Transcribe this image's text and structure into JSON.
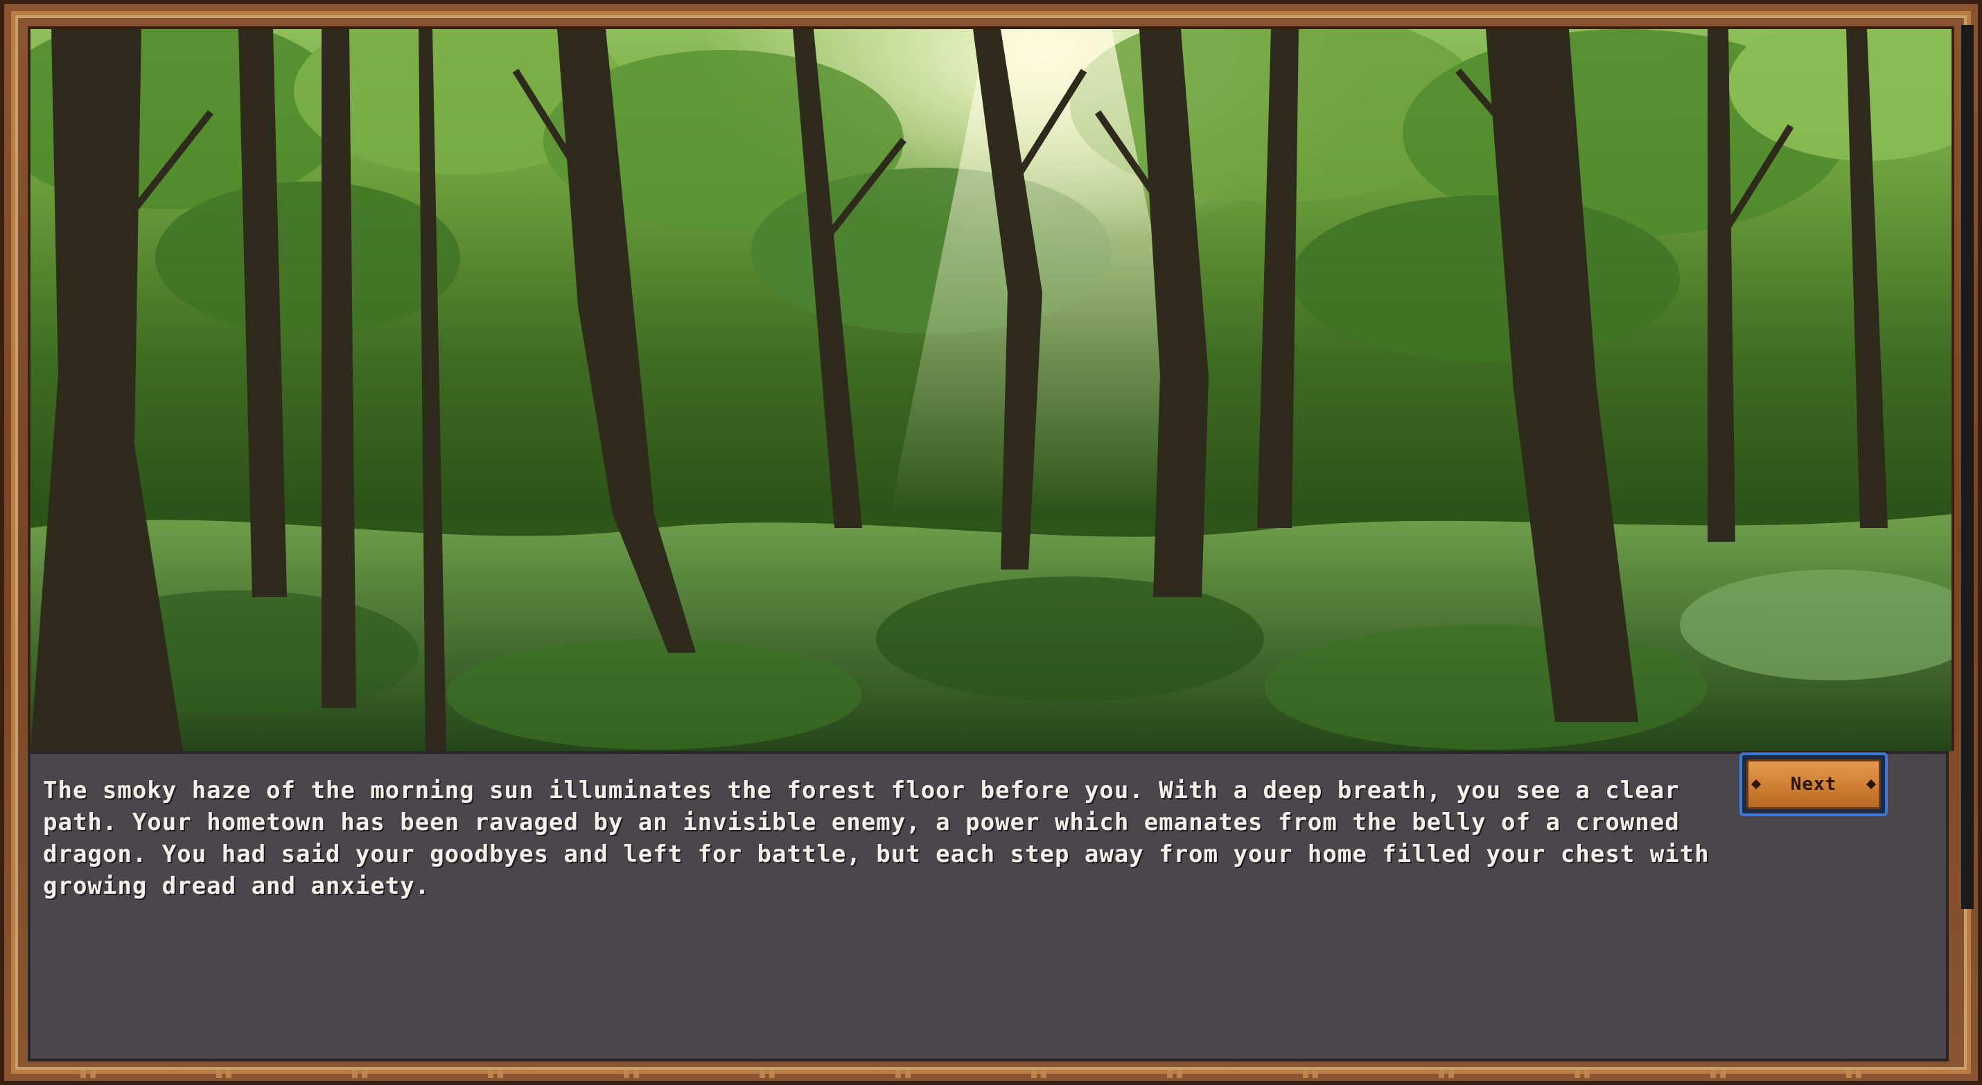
{
  "scene": {
    "colors": {
      "sky": "#dff0c8",
      "canopy": "#5f9535",
      "trunk": "#2e2a1c",
      "undergrowth": "#3a6a22"
    }
  },
  "dialog": {
    "narration": "The smoky haze of the morning sun illuminates the forest floor before you. With a deep breath, you see a clear path. Your hometown has been ravaged by an invisible enemy, a power which emanates from the belly of a crowned dragon. You had said your goodbyes and left for battle, but each step away from your home filled your chest with growing dread and anxiety.",
    "next_label": "Next"
  },
  "colors": {
    "frame": "#7a4526",
    "textbox_bg": "#4a464b",
    "text": "#f2f0ea",
    "button_border": "#3d7ad6",
    "button_wood": "#cf7f33"
  }
}
